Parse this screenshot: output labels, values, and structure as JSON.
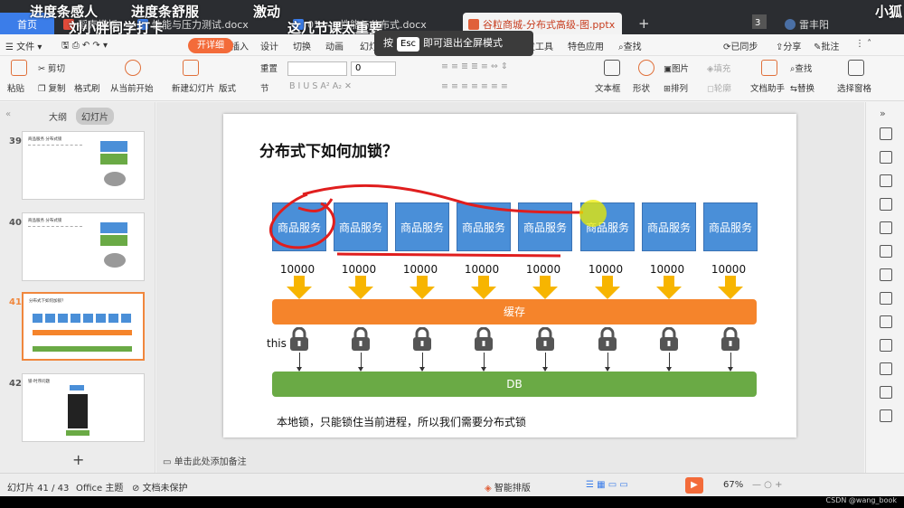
{
  "overlay": {
    "top1": "进度条感人",
    "top2": "进度条舒服",
    "top3": "激动",
    "top4": "小狐",
    "line2a": "刘小胖同学打卡",
    "line2b": "这几节课太重要",
    "line3": "开详细"
  },
  "tabs": [
    {
      "label": "首页"
    },
    {
      "label": "稻壳模板"
    },
    {
      "label": "性能与压力测试.docx"
    },
    {
      "label": "01——性能与分布式.docx"
    },
    {
      "label": "谷粒商城-分布式高级-图.pptx"
    }
  ],
  "tab_extra": {
    "counter": "3",
    "user": "雷丰阳"
  },
  "menu": {
    "file": "文件",
    "start": "开始",
    "insert": "插入",
    "design": "设计",
    "switch": "切换",
    "animation": "动画",
    "slideshow": "幻灯片放映",
    "tools": "开发工具",
    "features": "特色应用",
    "search": "查找",
    "sync": "已同步",
    "share": "分享",
    "comment": "批注"
  },
  "esc_tip": {
    "prefix": "按",
    "key": "Esc",
    "suffix": "即可退出全屏模式"
  },
  "toolbar": {
    "paste": "粘贴",
    "cut": "剪切",
    "copy": "复制",
    "format": "格式刷",
    "from_start": "从当前开始",
    "new_slide": "新建幻灯片",
    "layout": "版式",
    "section": "节",
    "reset": "重置",
    "font_size": "0",
    "textbox": "文本框",
    "shape": "形状",
    "picture": "图片",
    "fill": "填充",
    "arrange": "排列",
    "outline": "轮廓",
    "assistant": "文档助手",
    "find": "查找",
    "replace": "替换",
    "select_pane": "选择窗格"
  },
  "leftpanel": {
    "outline": "大纲",
    "slides": "幻灯片",
    "add": "+"
  },
  "thumbs": [
    {
      "num": "39",
      "title": "商品服务 分布式锁"
    },
    {
      "num": "40",
      "title": "商品服务 分布式锁"
    },
    {
      "num": "41",
      "title": "分布式下如何加锁？"
    },
    {
      "num": "42",
      "title": "锁-时序问题"
    }
  ],
  "slide": {
    "title": "分布式下如何加锁？",
    "nodes": [
      "商品服务",
      "商品服务",
      "商品服务",
      "商品服务",
      "商品服务",
      "商品服务",
      "商品服务",
      "商品服务"
    ],
    "quantities": [
      "10000",
      "10000",
      "10000",
      "10000",
      "10000",
      "10000",
      "10000",
      "10000"
    ],
    "cache": "缓存",
    "this_label": "this",
    "db": "DB",
    "note": "本地锁，只能锁住当前进程，所以我们需要分布式锁"
  },
  "notes_placeholder": "单击此处添加备注",
  "status": {
    "slide_count": "幻灯片 41 / 43",
    "theme": "Office 主题",
    "protect": "文档未保护",
    "smart": "智能排版",
    "zoom": "67%",
    "watermark": "CSDN @wang_book"
  },
  "colors": {
    "node": "#4a8fd8",
    "arrow": "#f7b500",
    "cache": "#f5842b",
    "db": "#6aaa45",
    "selected": "#f0873d",
    "accent": "#3b7de9"
  }
}
